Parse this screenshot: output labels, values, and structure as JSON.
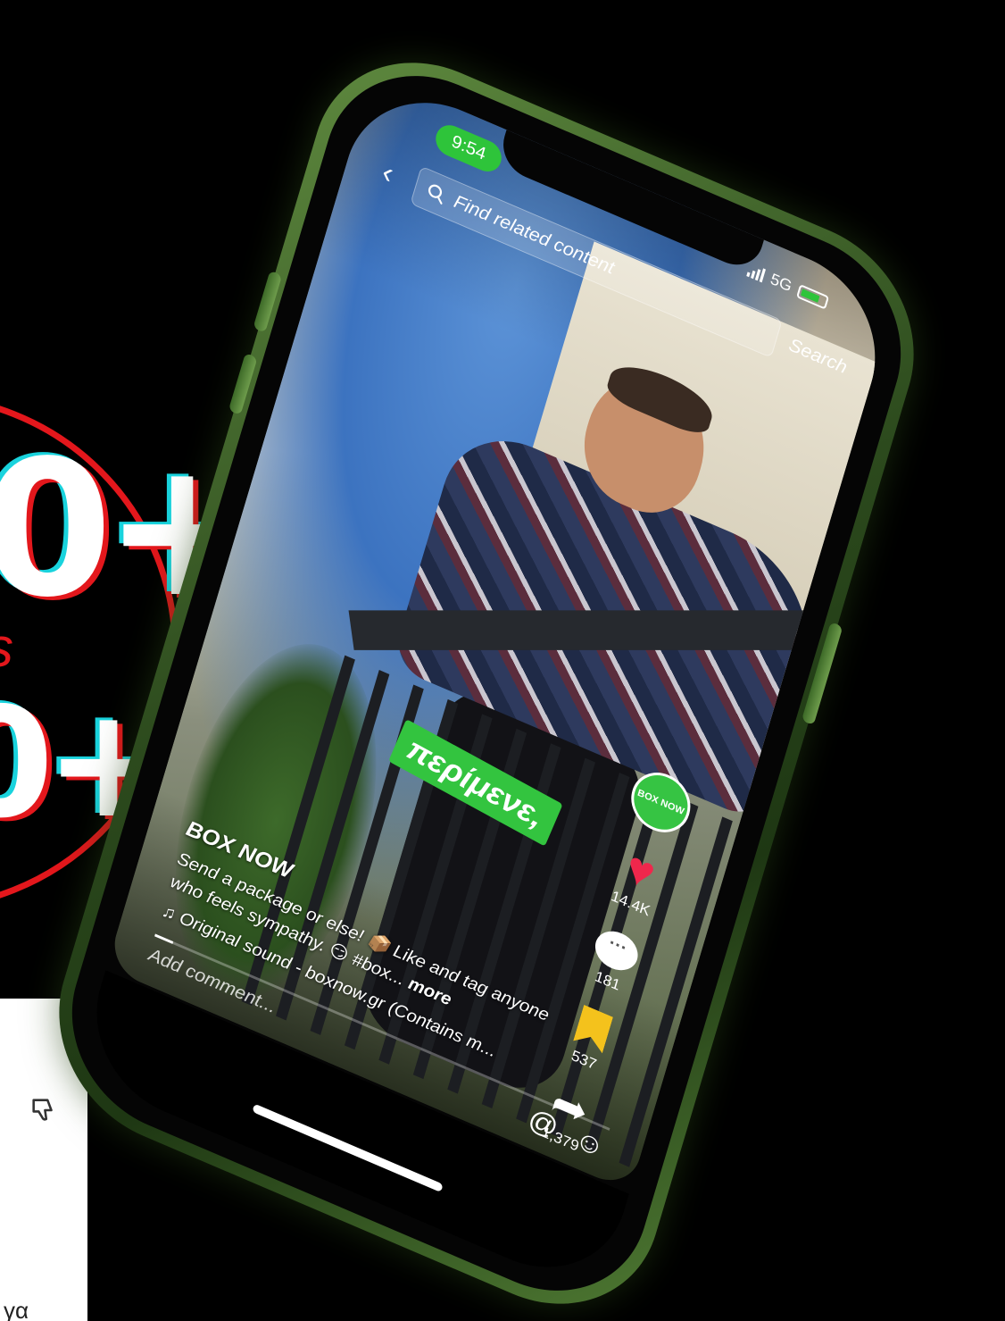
{
  "promo": {
    "stat_primary": "0+",
    "stat_label": "s",
    "stat_secondary": "0+",
    "comment_fragment": "γα"
  },
  "status_bar": {
    "time": "9:54",
    "network": "5G"
  },
  "search": {
    "placeholder": "Find related content",
    "button_label": "Search"
  },
  "video": {
    "caption_sticker": "περίμενε,",
    "author": "BOX NOW",
    "caption": "Send a package or else! 📦 Like and tag anyone who feels sympathy. 😏 #box...",
    "more_label": "more",
    "sound": "Original sound - boxnow.gr (Contains m...",
    "progress_fraction": 0.04
  },
  "actions": {
    "avatar_label": "BOX NOW",
    "likes": "14.4K",
    "comments": "181",
    "saves": "537",
    "shares": "1,379"
  },
  "comment_bar": {
    "placeholder": "Add comment...",
    "mention_icon": "@",
    "emoji_icon": "☺"
  },
  "colors": {
    "brand_green": "#33c43f",
    "promo_red": "#e3171c",
    "like_red": "#f0274c",
    "save_yellow": "#f4c21c"
  }
}
